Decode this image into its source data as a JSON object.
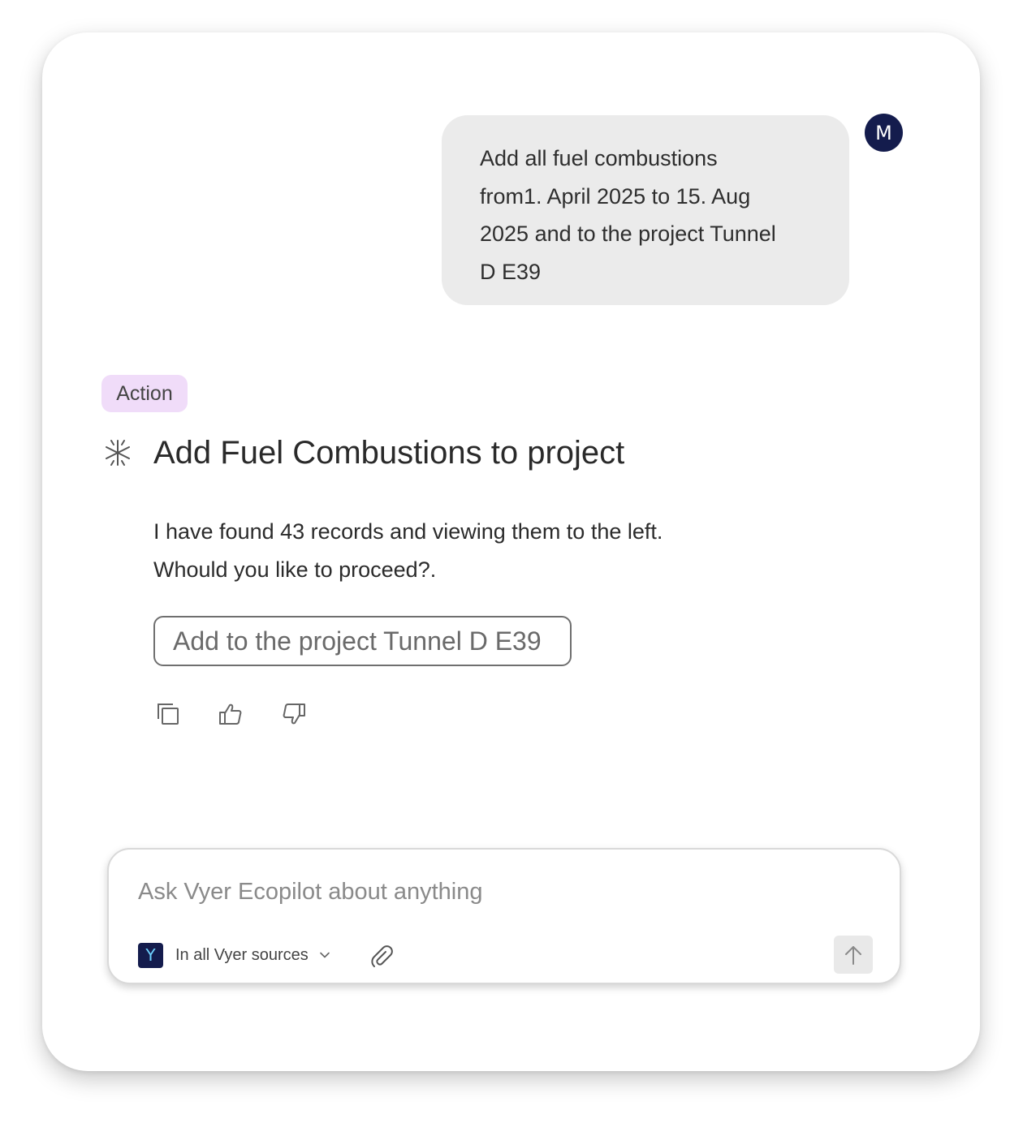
{
  "user": {
    "avatar_initial": "M",
    "message_lines": [
      "Add all fuel combustions",
      "from1. April 2025 to 15. Aug",
      "2025 and to the project Tunnel",
      "D E39"
    ]
  },
  "assistant": {
    "badge": "Action",
    "title_icon": "sparkle-asterisk-icon",
    "title": "Add Fuel Combustions to project",
    "response_lines": [
      "I have found 43 records and viewing them to the left.",
      "Whould you like to proceed?."
    ],
    "action_button_label": "Add to the project Tunnel D E39",
    "feedback_icons": [
      "copy-icon",
      "thumbs-up-icon",
      "thumbs-down-icon"
    ]
  },
  "composer": {
    "placeholder": "Ask Vyer Ecopilot about anything",
    "value": "",
    "source_logo": "Y",
    "source_label": "In all Vyer sources",
    "attach_icon": "paperclip-icon",
    "send_icon": "arrow-up-icon"
  },
  "colors": {
    "avatar_bg": "#141c4d",
    "user_bubble_bg": "#ebebeb",
    "badge_bg": "#f0dcf9",
    "send_button_bg": "#e9e9e9"
  }
}
